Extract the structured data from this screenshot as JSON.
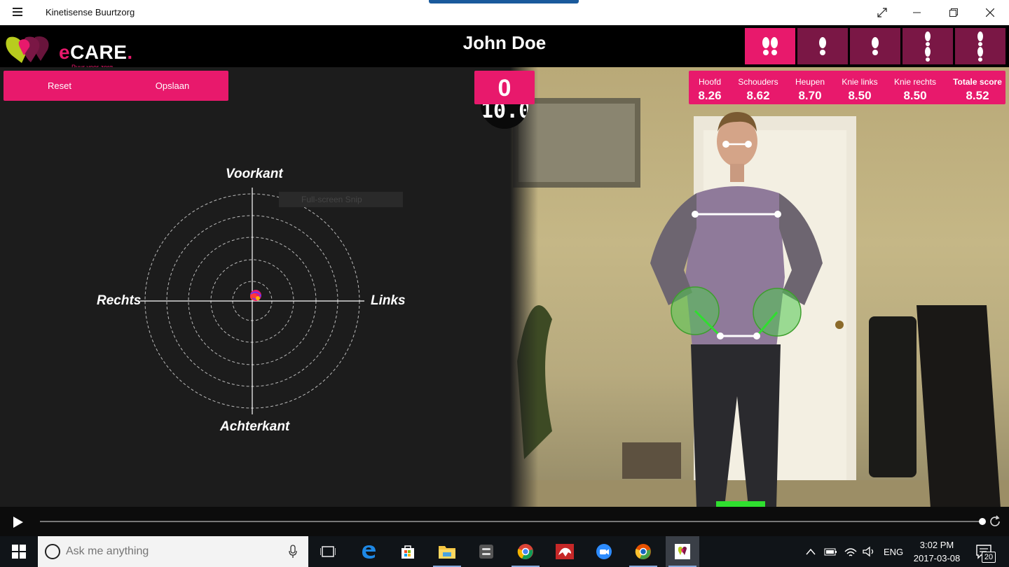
{
  "window": {
    "title": "Kinetisense Buurtzorg"
  },
  "header": {
    "logo_text": "eCARE",
    "logo_tagline": "Puur voor zorg",
    "patient_name": "John Doe",
    "stances": [
      {
        "name": "both-feet",
        "active": true
      },
      {
        "name": "single-foot-left",
        "active": false
      },
      {
        "name": "single-foot-right",
        "active": false
      },
      {
        "name": "tandem-left",
        "active": false
      },
      {
        "name": "tandem-right",
        "active": false
      }
    ]
  },
  "actions": {
    "reset_label": "Reset",
    "save_label": "Opslaan"
  },
  "target": {
    "front_label": "Voorkant",
    "back_label": "Achterkant",
    "right_label": "Rechts",
    "left_label": "Links"
  },
  "snip_hint": "Full-screen Snip",
  "counter": {
    "score": "0",
    "timer": "10.0"
  },
  "scores": [
    {
      "label": "Hoofd",
      "value": "8.26"
    },
    {
      "label": "Schouders",
      "value": "8.62"
    },
    {
      "label": "Heupen",
      "value": "8.70"
    },
    {
      "label": "Knie links",
      "value": "8.50"
    },
    {
      "label": "Knie rechts",
      "value": "8.50"
    },
    {
      "label": "Totale score",
      "value": "8.52",
      "bold": true
    }
  ],
  "playback": {
    "progress_percent": 100
  },
  "taskbar": {
    "search_placeholder": "Ask me anything",
    "language": "ENG",
    "time": "3:02 PM",
    "date": "2017-03-08",
    "notification_count": "20"
  },
  "colors": {
    "accent": "#e8196c",
    "accent_dark": "#7a1745",
    "panel_bg": "#1c1c1c"
  }
}
